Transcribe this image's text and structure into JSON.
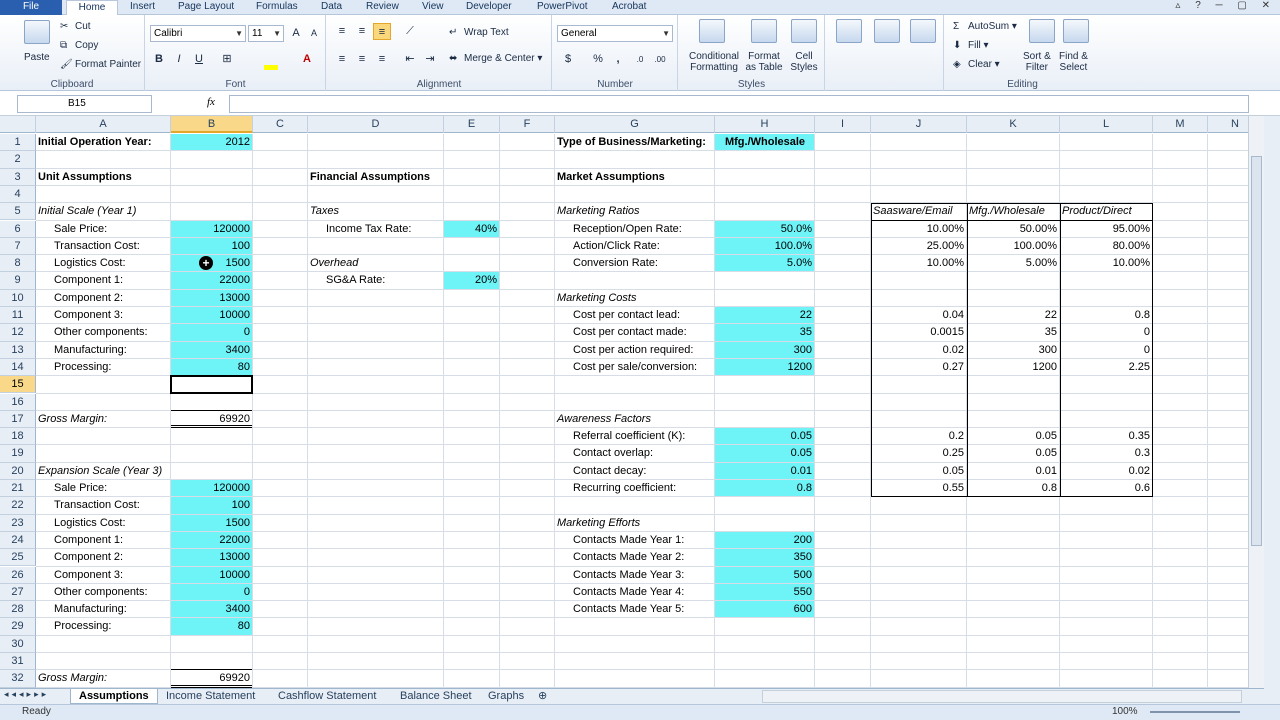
{
  "ribbon_tabs": [
    "File",
    "Home",
    "Insert",
    "Page Layout",
    "Formulas",
    "Data",
    "Review",
    "View",
    "Developer",
    "PowerPivot",
    "Acrobat"
  ],
  "clipboard": {
    "paste": "Paste",
    "cut": "Cut",
    "copy": "Copy",
    "format_painter": "Format Painter",
    "label": "Clipboard"
  },
  "font": {
    "name": "Calibri",
    "size": "11",
    "label": "Font",
    "bold": "B",
    "italic": "I",
    "underline": "U"
  },
  "alignment": {
    "wrap": "Wrap Text",
    "merge": "Merge & Center",
    "label": "Alignment"
  },
  "number": {
    "format": "General",
    "currency": "$",
    "percent": "%",
    "comma": ",",
    "label": "Number"
  },
  "styles": {
    "conditional": "Conditional",
    "conditional2": "Formatting",
    "format_table": "Format",
    "format_table2": "as Table",
    "cell_styles": "Cell",
    "cell_styles2": "Styles",
    "label": "Styles"
  },
  "cells": {
    "A1": "Initial Operation Year:",
    "B1": "2012",
    "G1": "Type of Business/Marketing:",
    "H1": "Mfg./Wholesale",
    "A3": "Unit Assumptions",
    "D3": "Financial Assumptions",
    "G3": "Market Assumptions",
    "A5": "Initial Scale (Year 1)",
    "D5": "Taxes",
    "G5": "Marketing Ratios",
    "J5": "Saasware/Email",
    "K5": "Mfg./Wholesale",
    "L5": "Product/Direct",
    "A6": "Sale Price:",
    "B6": "120000",
    "D6": "Income Tax Rate:",
    "E6": "40%",
    "G6": "Reception/Open Rate:",
    "H6": "50.0%",
    "J6": "10.00%",
    "K6": "50.00%",
    "L6": "95.00%",
    "A7": "Transaction Cost:",
    "B7": "100",
    "G7": "Action/Click Rate:",
    "H7": "100.0%",
    "J7": "25.00%",
    "K7": "100.00%",
    "L7": "80.00%",
    "A8": "Logistics Cost:",
    "B8": "1500",
    "D8": "Overhead",
    "G8": "Conversion Rate:",
    "H8": "5.0%",
    "J8": "10.00%",
    "K8": "5.00%",
    "L8": "10.00%",
    "A9": "Component 1:",
    "B9": "22000",
    "D9": "SG&A Rate:",
    "E9": "20%",
    "A10": "Component 2:",
    "B10": "13000",
    "G10": "Marketing Costs",
    "A11": "Component 3:",
    "B11": "10000",
    "G11": "Cost per contact lead:",
    "H11": "22",
    "J11": "0.04",
    "K11": "22",
    "L11": "0.8",
    "A12": "Other components:",
    "B12": "0",
    "G12": "Cost per contact made:",
    "H12": "35",
    "J12": "0.0015",
    "K12": "35",
    "L12": "0",
    "A13": "Manufacturing:",
    "B13": "3400",
    "G13": "Cost per action required:",
    "H13": "300",
    "J13": "0.02",
    "K13": "300",
    "L13": "0",
    "A14": "Processing:",
    "B14": "80",
    "G14": "Cost per sale/conversion:",
    "H14": "1200",
    "J14": "0.27",
    "K14": "1200",
    "L14": "2.25",
    "A17": "Gross Margin:",
    "B17": "69920",
    "G17": "Awareness Factors",
    "G18": "Referral coefficient (K):",
    "H18": "0.05",
    "J18": "0.2",
    "K18": "0.05",
    "L18": "0.35",
    "G19": "Contact overlap:",
    "H19": "0.05",
    "J19": "0.25",
    "K19": "0.05",
    "L19": "0.3",
    "G20": "Contact decay:",
    "H20": "0.01",
    "J20": "0.05",
    "K20": "0.01",
    "L20": "0.02",
    "A20": "Expansion Scale (Year 3)",
    "A21": "Sale Price:",
    "B21": "120000",
    "G21": "Recurring coefficient:",
    "H21": "0.8",
    "J21": "0.55",
    "K21": "0.8",
    "L21": "0.6",
    "A22": "Transaction Cost:",
    "B22": "100",
    "A23": "Logistics Cost:",
    "B23": "1500",
    "G23": "Marketing Efforts",
    "A24": "Component 1:",
    "B24": "22000",
    "G24": "Contacts Made Year 1:",
    "H24": "200",
    "A25": "Component 2:",
    "B25": "13000",
    "G25": "Contacts Made Year 2:",
    "H25": "350",
    "A26": "Component 3:",
    "B26": "10000",
    "G26": "Contacts Made Year 3:",
    "H26": "500",
    "A27": "Other components:",
    "B27": "0",
    "G27": "Contacts Made Year 4:",
    "H27": "550",
    "A28": "Manufacturing:",
    "B28": "3400",
    "G28": "Contacts Made Year 5:",
    "H28": "600",
    "A29": "Processing:",
    "B29": "80",
    "A32": "Gross Margin:",
    "B32": "69920"
  },
  "editing": {
    "autosum": "AutoSum",
    "fill": "Fill",
    "clear": "Clear",
    "sort": "Sort &",
    "sort2": "Filter",
    "find": "Find &",
    "find2": "Select",
    "label": "Editing"
  },
  "formula_bar": {
    "name_box": "B15",
    "fx": "fx",
    "value": ""
  },
  "columns": [
    "A",
    "B",
    "C",
    "D",
    "E",
    "F",
    "G",
    "H",
    "I",
    "J",
    "K",
    "L",
    "M",
    "N"
  ],
  "selected_col": "B",
  "selected_row": "15",
  "rows": [
    "1",
    "2",
    "3",
    "4",
    "5",
    "6",
    "7",
    "8",
    "9",
    "10",
    "11",
    "12",
    "13",
    "14",
    "15",
    "16",
    "17",
    "18",
    "19",
    "20",
    "21",
    "22",
    "23",
    "24",
    "25",
    "26",
    "27",
    "28",
    "29",
    "30",
    "31",
    "32"
  ],
  "sheet_tabs": [
    "Assumptions",
    "Income Statement",
    "Cashflow Statement",
    "Balance Sheet",
    "Graphs"
  ],
  "active_sheet": "Assumptions",
  "status": {
    "ready": "Ready",
    "zoom": "100%"
  }
}
